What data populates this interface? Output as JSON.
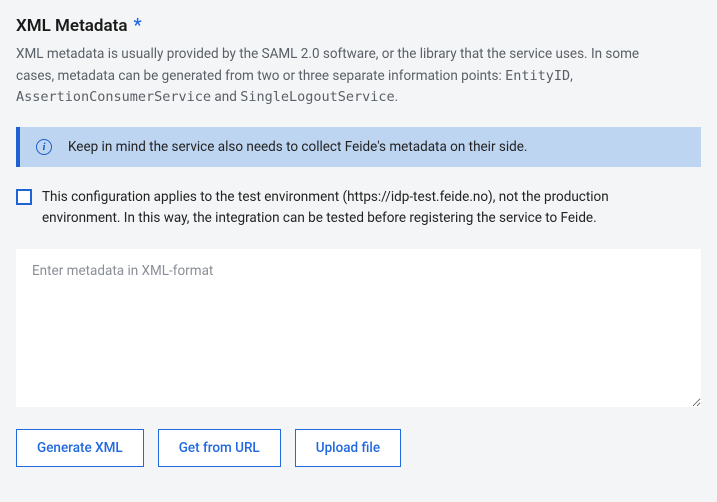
{
  "heading": "XML Metadata",
  "required_indicator": "*",
  "description": {
    "intro": "XML metadata is usually provided by the SAML 2.0 software, or the library that the service uses. In some cases, metadata can be generated from two or three separate information points: ",
    "code1": "EntityID",
    "sep1": ", ",
    "code2": "AssertionConsumerService",
    "sep2": " and ",
    "code3": "SingleLogoutService",
    "end": "."
  },
  "info_banner": {
    "text": "Keep in mind the service also needs to collect Feide's metadata on their side."
  },
  "checkbox": {
    "label": "This configuration applies to the test environment (https://idp-test.feide.no), not the production environment. In this way, the integration can be tested before registering the service to Feide."
  },
  "textarea": {
    "placeholder": "Enter metadata in XML-format",
    "value": ""
  },
  "buttons": {
    "generate": "Generate XML",
    "get_url": "Get from URL",
    "upload": "Upload file"
  }
}
